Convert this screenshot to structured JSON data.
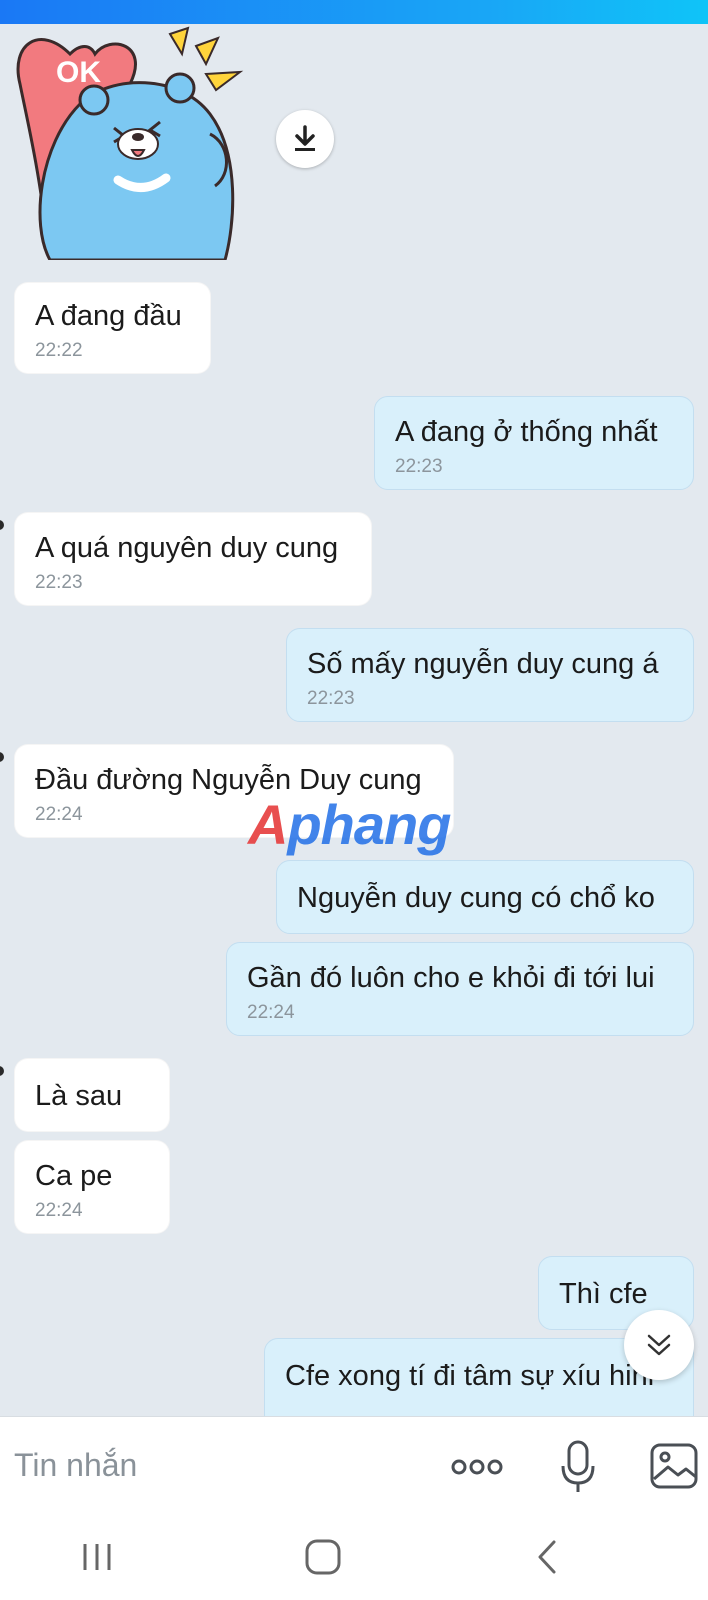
{
  "messages": [
    {
      "text": "A đang đầu",
      "time": "22:22"
    },
    {
      "text": "A đang ở thống nhất",
      "time": "22:23"
    },
    {
      "text": "A quá nguyên duy cung",
      "time": "22:23"
    },
    {
      "text": "Số mấy nguyễn duy cung á",
      "time": "22:23"
    },
    {
      "text": "Đầu đường Nguyễn Duy cung",
      "time": "22:24"
    },
    {
      "text": "Nguyễn duy cung có chổ ko",
      "time": ""
    },
    {
      "text": "Gần đó luôn cho e khỏi đi tới lui",
      "time": "22:24"
    },
    {
      "text": "Là sau",
      "time": ""
    },
    {
      "text": "Ca pe",
      "time": "22:24"
    },
    {
      "text": "Thì cfe",
      "time": ""
    },
    {
      "text": "Cfe xong tí đi tâm sự xíu hihi",
      "time": ""
    }
  ],
  "sticker": {
    "label": "OK"
  },
  "watermark": {
    "first": "A",
    "rest": "phang"
  },
  "composer": {
    "placeholder": "Tin nhắn"
  },
  "icons": [
    "download-icon",
    "scroll-down-icon",
    "more-icon",
    "microphone-icon",
    "image-icon",
    "recent-apps-icon",
    "home-icon",
    "back-icon"
  ],
  "colors": {
    "accent": "#1a78f5",
    "incoming_bubble": "#ffffff",
    "outgoing_bubble": "#d9f0fb",
    "background": "#e3e9ef"
  }
}
